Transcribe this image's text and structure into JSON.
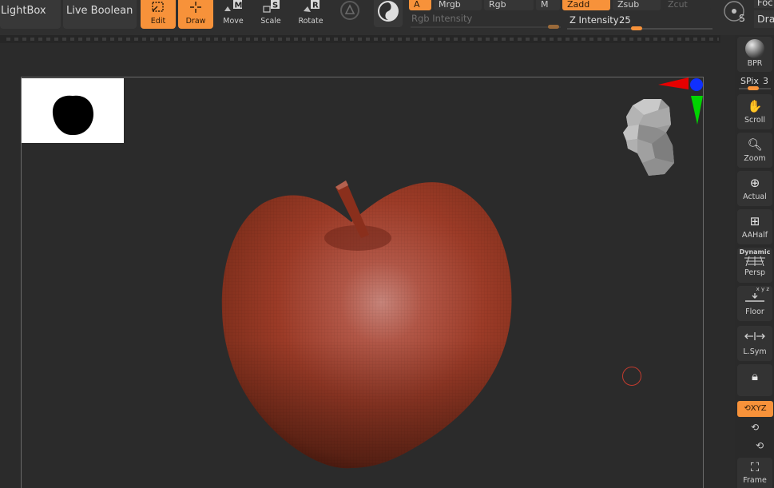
{
  "toolbar": {
    "lightbox_label": "LightBox",
    "live_boolean_label": "Live Boolean",
    "tools": [
      {
        "label": "Edit",
        "active": true
      },
      {
        "label": "Draw",
        "active": true
      },
      {
        "label": "Move",
        "active": false,
        "key": "M"
      },
      {
        "label": "Scale",
        "active": false,
        "key": "S"
      },
      {
        "label": "Rotate",
        "active": false,
        "key": "R"
      }
    ],
    "modes": {
      "a": "A",
      "mrgb": "Mrgb",
      "rgb": "Rgb",
      "m": "M",
      "zadd": "Zadd",
      "zsub": "Zsub",
      "zcut": "Zcut"
    },
    "rgb_intensity_label": "Rgb Intensity",
    "z_intensity_label": "Z Intensity",
    "z_intensity_value": "25",
    "focal_label": "Foc",
    "draw_size_label": "Dra",
    "accent_color": "#f7923a"
  },
  "shelf": {
    "bpr_label": "BPR",
    "spix_label": "SPix",
    "spix_value": "3",
    "buttons": [
      {
        "label": "Scroll",
        "icon": "hand-icon"
      },
      {
        "label": "Zoom",
        "icon": "zoom-icon"
      },
      {
        "label": "Actual",
        "icon": "zoom-actual-icon"
      },
      {
        "label": "AAHalf",
        "icon": "aa-half-icon"
      },
      {
        "label": "Persp",
        "icon": "perspective-icon",
        "sublabel": "Dynamic"
      },
      {
        "label": "Floor",
        "icon": "floor-icon",
        "sublabel": "x y z"
      },
      {
        "label": "L.Sym",
        "icon": "local-symmetry-icon"
      },
      {
        "label": "XYZ",
        "icon": "xyz-rotate-icon",
        "active": true
      },
      {
        "label": "Frame",
        "icon": "frame-icon"
      }
    ]
  },
  "canvas": {
    "model_color": "#a23a28",
    "cursor_color": "#c23b2e"
  }
}
